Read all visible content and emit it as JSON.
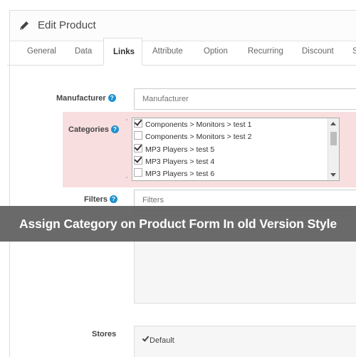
{
  "panel": {
    "title": "Edit Product"
  },
  "tabs": [
    "General",
    "Data",
    "Links",
    "Attribute",
    "Option",
    "Recurring",
    "Discount",
    "S"
  ],
  "active_tab": "Links",
  "form": {
    "manufacturer": {
      "label": "Manufacturer",
      "placeholder": "Manufacturer"
    },
    "categories": {
      "label": "Categories",
      "items": [
        {
          "label": "Components  >  Monitors  >  test 1",
          "checked": true
        },
        {
          "label": "Components  >  Monitors  >  test 2",
          "checked": false
        },
        {
          "label": "MP3 Players  >  test 5",
          "checked": true
        },
        {
          "label": "MP3 Players  >  test 4",
          "checked": true
        },
        {
          "label": "MP3 Players  >  test 6",
          "checked": false
        }
      ]
    },
    "filters": {
      "label": "Filters",
      "placeholder": "Filters"
    },
    "stores": {
      "label": "Stores",
      "items": [
        {
          "label": "Default",
          "checked": true
        }
      ]
    }
  },
  "help_icon_glyph": "?",
  "banner": {
    "text": "Assign Category on Product Form In old Version Style"
  },
  "colors": {
    "help_icon": "#1e91cf",
    "categories_highlight": "#f8dede",
    "banner_bg": "#5f5f5f"
  }
}
